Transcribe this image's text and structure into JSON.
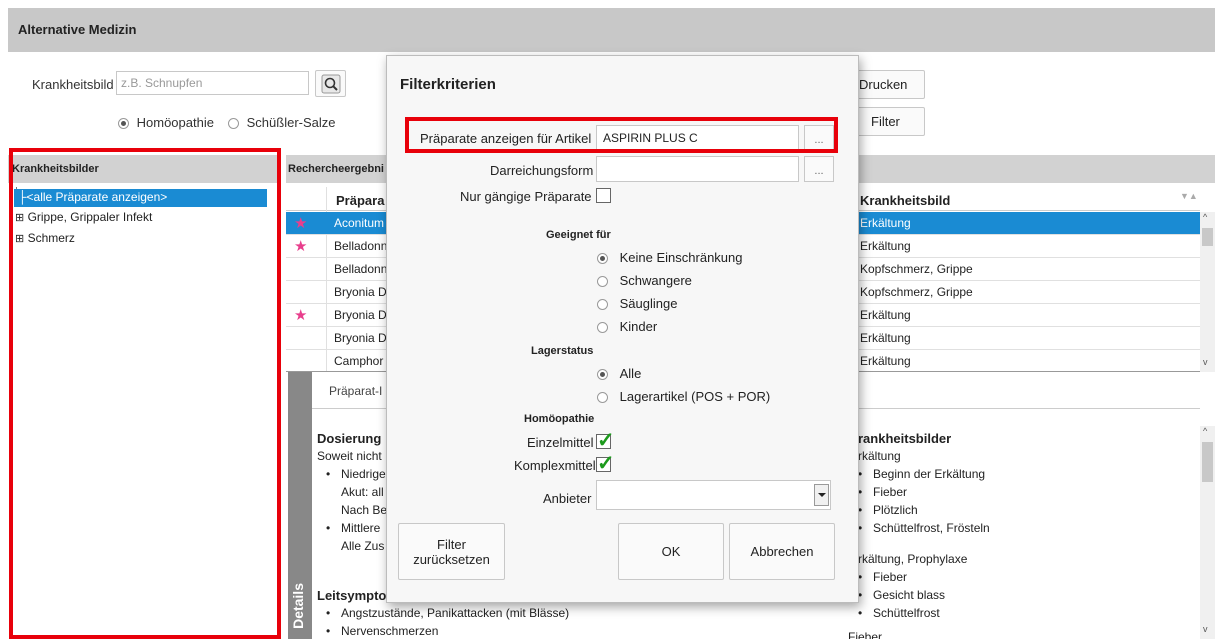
{
  "app": {
    "title": "Alternative Medizin"
  },
  "search": {
    "label": "Krankheitsbild",
    "placeholder": "z.B. Schnupfen",
    "radio_homoeopathie": "Homöopathie",
    "radio_schuessler": "Schüßler-Salze"
  },
  "toolbar": {
    "print_label": "Drucken",
    "filter_label": "Filter"
  },
  "left_panel": {
    "header": "Krankheitsbilder",
    "items": [
      "<alle Präparate anzeigen>",
      "Grippe, Grippaler Infekt",
      "Schmerz"
    ]
  },
  "results": {
    "header": "Rechercheergebni",
    "col_praeparat": "Präpara",
    "col_krankheitsbild": "Krankheitsbild",
    "rows": [
      {
        "name": "Aconitum",
        "krankheit": "Erkältung"
      },
      {
        "name": "Belladonn",
        "krankheit": "Erkältung"
      },
      {
        "name": "Belladonn",
        "krankheit": "Kopfschmerz, Grippe"
      },
      {
        "name": "Bryonia D",
        "krankheit": "Kopfschmerz, Grippe"
      },
      {
        "name": "Bryonia D",
        "krankheit": "Erkältung"
      },
      {
        "name": "Bryonia D",
        "krankheit": "Erkältung"
      },
      {
        "name": "Camphor",
        "krankheit": "Erkältung"
      }
    ]
  },
  "details": {
    "tab_label": "Details",
    "subtab": "Präparat-I",
    "dosierung_title": "Dosierung",
    "dosierung_lines": [
      "Soweit nicht",
      "Niedrige",
      "Akut: all",
      "Nach Be",
      "Mittlere",
      "Alle Zus"
    ],
    "leitsymptome_title": "Leitsympto",
    "leitsymptome": [
      "Angstzustände, Panikattacken (mit Blässe)",
      "Nervenschmerzen"
    ],
    "krankheitsbilder_title": "rankheitsbilder",
    "kb_group1": "rkältung",
    "kb_items1": [
      "Beginn der Erkältung",
      "Fieber",
      "Plötzlich",
      "Schüttelfrost, Frösteln"
    ],
    "kb_group2": "rkältung, Prophylaxe",
    "kb_items2": [
      "Fieber",
      "Gesicht blass",
      "Schüttelfrost"
    ],
    "kb_group3": "Fieber"
  },
  "dialog": {
    "title": "Filterkriterien",
    "artikel_label": "Präparate anzeigen für Artikel",
    "artikel_value": "ASPIRIN PLUS C",
    "dots": "...",
    "darreichung_label": "Darreichungsform",
    "nur_gaengige_label": "Nur gängige Präparate",
    "geeignet_title": "Geeignet für",
    "geeignet_options": [
      "Keine Einschränkung",
      "Schwangere",
      "Säuglinge",
      "Kinder"
    ],
    "lager_title": "Lagerstatus",
    "lager_options": [
      "Alle",
      "Lagerartikel (POS + POR)"
    ],
    "homoeo_title": "Homöopathie",
    "einzelmittel_label": "Einzelmittel",
    "komplexmittel_label": "Komplexmittel",
    "anbieter_label": "Anbieter",
    "reset_line1": "Filter",
    "reset_line2": "zurücksetzen",
    "ok_label": "OK",
    "cancel_label": "Abbrechen"
  }
}
